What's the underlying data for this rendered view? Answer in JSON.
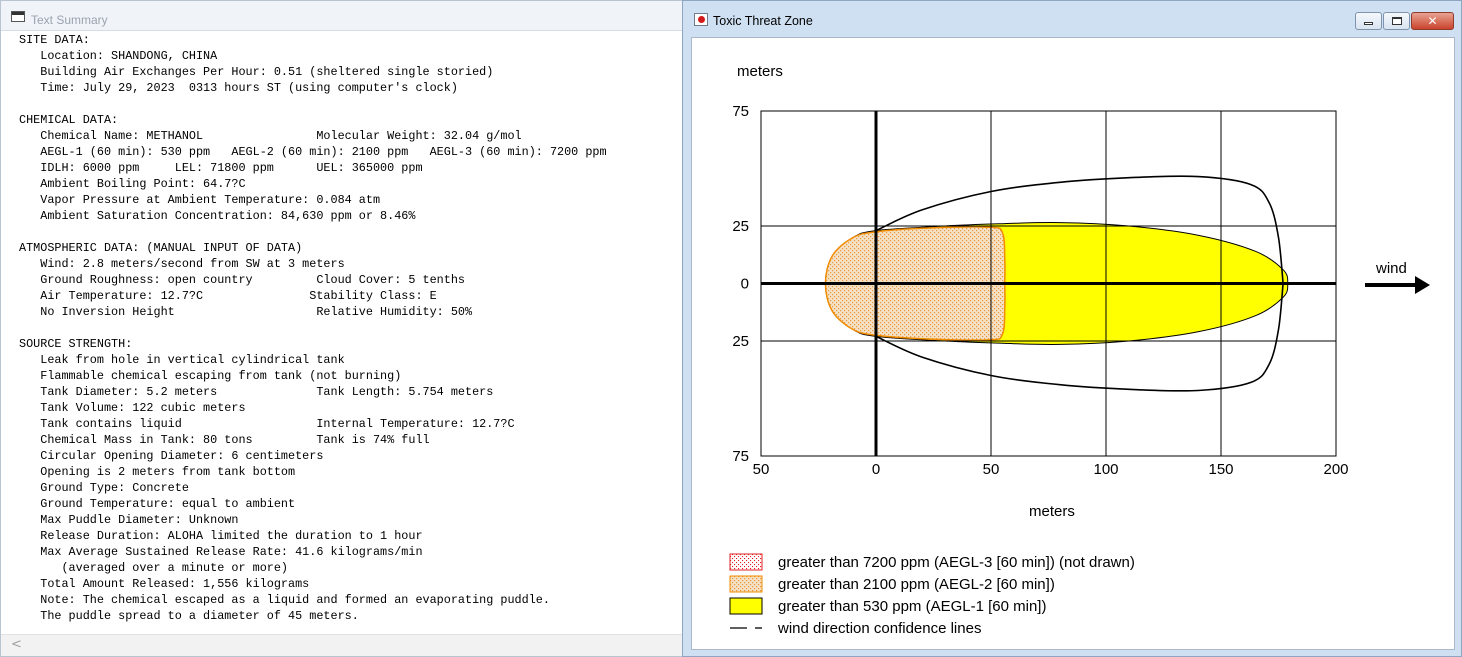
{
  "summary_window": {
    "title": "Text Summary",
    "lines": [
      "SITE DATA:",
      "   Location: SHANDONG, CHINA",
      "   Building Air Exchanges Per Hour: 0.51 (sheltered single storied)",
      "   Time: July 29, 2023  0313 hours ST (using computer's clock)",
      "",
      "CHEMICAL DATA:",
      "   Chemical Name: METHANOL                Molecular Weight: 32.04 g/mol",
      "   AEGL-1 (60 min): 530 ppm   AEGL-2 (60 min): 2100 ppm   AEGL-3 (60 min): 7200 ppm",
      "   IDLH: 6000 ppm     LEL: 71800 ppm      UEL: 365000 ppm",
      "   Ambient Boiling Point: 64.7?C",
      "   Vapor Pressure at Ambient Temperature: 0.084 atm",
      "   Ambient Saturation Concentration: 84,630 ppm or 8.46%",
      "",
      "ATMOSPHERIC DATA: (MANUAL INPUT OF DATA)",
      "   Wind: 2.8 meters/second from SW at 3 meters",
      "   Ground Roughness: open country         Cloud Cover: 5 tenths",
      "   Air Temperature: 12.7?C               Stability Class: E",
      "   No Inversion Height                    Relative Humidity: 50%",
      "",
      "SOURCE STRENGTH:",
      "   Leak from hole in vertical cylindrical tank",
      "   Flammable chemical escaping from tank (not burning)",
      "   Tank Diameter: 5.2 meters              Tank Length: 5.754 meters",
      "   Tank Volume: 122 cubic meters",
      "   Tank contains liquid                   Internal Temperature: 12.7?C",
      "   Chemical Mass in Tank: 80 tons         Tank is 74% full",
      "   Circular Opening Diameter: 6 centimeters",
      "   Opening is 2 meters from tank bottom",
      "   Ground Type: Concrete",
      "   Ground Temperature: equal to ambient",
      "   Max Puddle Diameter: Unknown",
      "   Release Duration: ALOHA limited the duration to 1 hour",
      "   Max Average Sustained Release Rate: 41.6 kilograms/min",
      "      (averaged over a minute or more)",
      "   Total Amount Released: 1,556 kilograms",
      "   Note: The chemical escaped as a liquid and formed an evaporating puddle.",
      "   The puddle spread to a diameter of 45 meters."
    ],
    "scroll_arrow": "<"
  },
  "threat_window": {
    "title": "Toxic Threat Zone",
    "controls": {
      "minimize": "▭",
      "maximize": "▢",
      "close": "✕"
    },
    "y_axis_label": "meters",
    "x_axis_label": "meters",
    "wind_label": "wind",
    "legend": [
      {
        "label": "greater than 7200 ppm (AEGL-3 [60 min]) (not drawn)",
        "swatch": "red-dots"
      },
      {
        "label": "greater than 2100 ppm (AEGL-2 [60 min])",
        "swatch": "orange-dots"
      },
      {
        "label": "greater than 530 ppm (AEGL-1 [60 min])",
        "swatch": "yellow"
      },
      {
        "label": "wind direction confidence lines",
        "swatch": "dashed-line"
      }
    ],
    "colors": {
      "aegl1": "#ffff00",
      "aegl2_fill": "#f4dfc0",
      "aegl2_edge": "#f28c00",
      "aegl3": "#e02020",
      "confidence": "#000000"
    }
  },
  "chart_data": {
    "type": "area",
    "xlabel": "meters",
    "ylabel": "meters",
    "xlim": [
      -50,
      200
    ],
    "ylim": [
      -75,
      75
    ],
    "x_ticks": [
      {
        "value": -50,
        "label": "50"
      },
      {
        "value": 0,
        "label": "0"
      },
      {
        "value": 50,
        "label": "50"
      },
      {
        "value": 100,
        "label": "100"
      },
      {
        "value": 150,
        "label": "150"
      },
      {
        "value": 200,
        "label": "200"
      }
    ],
    "y_ticks": [
      {
        "value": 75,
        "label": "75"
      },
      {
        "value": 25,
        "label": "25"
      },
      {
        "value": 0,
        "label": "0"
      },
      {
        "value": -25,
        "label": "25"
      },
      {
        "value": -75,
        "label": "75"
      }
    ],
    "grid": true,
    "zones": [
      {
        "name": "AEGL-1",
        "fill": "#ffff00",
        "outline": [
          [
            -22,
            0
          ],
          [
            -19,
            12
          ],
          [
            -10,
            20
          ],
          [
            0,
            23
          ],
          [
            30,
            25
          ],
          [
            55,
            26
          ],
          [
            80,
            26.5
          ],
          [
            110,
            25
          ],
          [
            140,
            21
          ],
          [
            165,
            14
          ],
          [
            177,
            6
          ],
          [
            179,
            0
          ],
          [
            177,
            -6
          ],
          [
            165,
            -14
          ],
          [
            140,
            -21
          ],
          [
            110,
            -25
          ],
          [
            80,
            -26.5
          ],
          [
            55,
            -26
          ],
          [
            30,
            -25
          ],
          [
            0,
            -23
          ],
          [
            -10,
            -20
          ],
          [
            -19,
            -12
          ]
        ]
      },
      {
        "name": "AEGL-2",
        "fill": "#f4dfc0",
        "outline": [
          [
            -22,
            0
          ],
          [
            -19,
            12
          ],
          [
            -10,
            20
          ],
          [
            0,
            22.5
          ],
          [
            20,
            24
          ],
          [
            49,
            24.5
          ],
          [
            55,
            22
          ],
          [
            56,
            10
          ],
          [
            56,
            0
          ],
          [
            56,
            -10
          ],
          [
            55,
            -22
          ],
          [
            49,
            -24.5
          ],
          [
            20,
            -24
          ],
          [
            0,
            -22.5
          ],
          [
            -10,
            -20
          ],
          [
            -19,
            -12
          ]
        ]
      }
    ],
    "confidence_lines": [
      {
        "name": "upper",
        "points": [
          [
            0,
            23
          ],
          [
            20,
            32
          ],
          [
            50,
            40
          ],
          [
            80,
            44
          ],
          [
            110,
            46
          ],
          [
            140,
            46.5
          ],
          [
            163,
            43
          ],
          [
            171,
            35
          ],
          [
            175,
            20
          ],
          [
            177,
            0
          ]
        ]
      },
      {
        "name": "lower",
        "points": [
          [
            0,
            -23
          ],
          [
            20,
            -32
          ],
          [
            50,
            -40
          ],
          [
            80,
            -44
          ],
          [
            110,
            -46
          ],
          [
            140,
            -46.5
          ],
          [
            163,
            -43
          ],
          [
            171,
            -35
          ],
          [
            175,
            -20
          ],
          [
            177,
            0
          ]
        ]
      }
    ]
  }
}
